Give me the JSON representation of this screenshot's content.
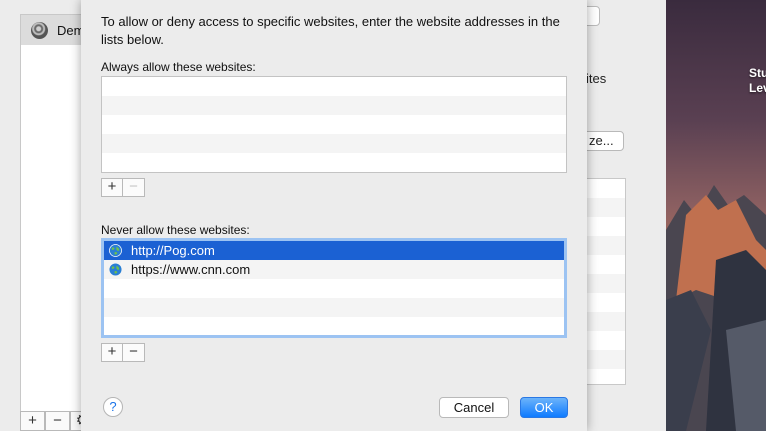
{
  "background": {
    "user_name": "Dem",
    "list_buttons": [
      "+",
      "−",
      "⚙"
    ],
    "partial_text": "ites",
    "partial_button": "ze...",
    "desktop_label_line1": "Stu",
    "desktop_label_line2": "Lev"
  },
  "sheet": {
    "instructions": "To allow or deny access to specific websites, enter the website addresses in the lists below.",
    "always": {
      "label": "Always allow these websites:",
      "sites": [],
      "add_label": "+",
      "remove_label": "−"
    },
    "never": {
      "label": "Never allow these websites:",
      "sites": [
        {
          "url": "http://Pog.com",
          "selected": true
        },
        {
          "url": "https://www.cnn.com",
          "selected": false
        }
      ],
      "add_label": "+",
      "remove_label": "−"
    },
    "help_label": "?",
    "cancel_label": "Cancel",
    "ok_label": "OK"
  },
  "icons": {
    "site_icon": "globe-icon",
    "help_icon": "question-mark-icon"
  },
  "colors": {
    "selection": "#1b61d3",
    "ok_button": "#0f7bff",
    "focus_ring": "#9cc3f2"
  }
}
